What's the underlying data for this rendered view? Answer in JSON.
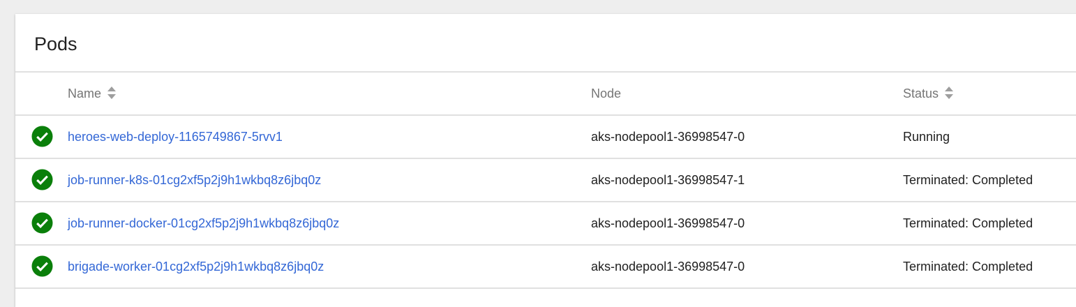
{
  "card": {
    "title": "Pods"
  },
  "columns": {
    "name": "Name",
    "node": "Node",
    "status": "Status"
  },
  "colors": {
    "ok": "#0a7f0a",
    "link": "#3367d6"
  },
  "rows": [
    {
      "icon": "check-circle-icon",
      "name": "heroes-web-deploy-1165749867-5rvv1",
      "node": "aks-nodepool1-36998547-0",
      "status": "Running"
    },
    {
      "icon": "check-circle-icon",
      "name": "job-runner-k8s-01cg2xf5p2j9h1wkbq8z6jbq0z",
      "node": "aks-nodepool1-36998547-1",
      "status": "Terminated: Completed"
    },
    {
      "icon": "check-circle-icon",
      "name": "job-runner-docker-01cg2xf5p2j9h1wkbq8z6jbq0z",
      "node": "aks-nodepool1-36998547-0",
      "status": "Terminated: Completed"
    },
    {
      "icon": "check-circle-icon",
      "name": "brigade-worker-01cg2xf5p2j9h1wkbq8z6jbq0z",
      "node": "aks-nodepool1-36998547-0",
      "status": "Terminated: Completed"
    }
  ]
}
